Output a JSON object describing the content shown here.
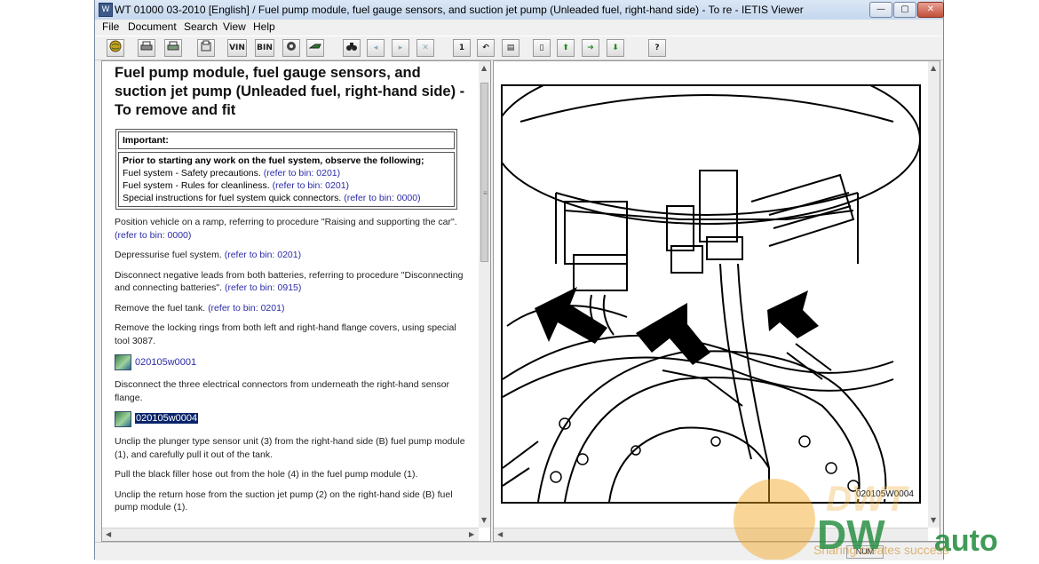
{
  "window": {
    "title": "WT 01000 03-2010 [English] / Fuel pump module, fuel gauge sensors, and suction jet pump (Unleaded fuel, right-hand side) - To re - IETIS Viewer",
    "min_symbol": "—",
    "max_symbol": "▢",
    "close_symbol": "✕"
  },
  "menu": [
    "File",
    "Document",
    "Search",
    "View",
    "Help"
  ],
  "toolbar": {
    "vin_label": "VIN",
    "bin_label": "BIN"
  },
  "document": {
    "title": "Fuel pump module, fuel gauge sensors, and suction jet pump (Unleaded fuel, right-hand side) - To remove and fit",
    "important": {
      "heading": "Important:",
      "lead": "Prior to starting any work on the fuel system, observe the following;",
      "items": [
        {
          "text": "Fuel system - Safety precautions. ",
          "ref": "(refer to bin: 0201)"
        },
        {
          "text": "Fuel system - Rules for cleanliness. ",
          "ref": "(refer to bin: 0201)"
        },
        {
          "text": "Special instructions for fuel system quick connectors. ",
          "ref": "(refer to bin: 0000)"
        }
      ]
    },
    "steps": [
      {
        "text": "Position vehicle on a ramp, referring to procedure \"Raising and supporting the car\". ",
        "ref": "(refer to bin: 0000)"
      },
      {
        "text": "Depressurise fuel system. ",
        "ref": "(refer to bin: 0201)"
      },
      {
        "text": "Disconnect negative leads from both batteries, referring to procedure \"Disconnecting and connecting batteries\". ",
        "ref": "(refer to bin: 0915)"
      },
      {
        "text": "Remove the fuel tank. ",
        "ref": "(refer to bin: 0201)"
      },
      {
        "text": "Remove the locking rings from both left and right-hand flange covers, using special tool 3087.",
        "ref": ""
      },
      {
        "text": "Disconnect the three electrical connectors from underneath the right-hand sensor flange.",
        "ref": ""
      },
      {
        "text": "Unclip the plunger type sensor unit (3) from the right-hand side (B) fuel pump module (1), and carefully pull it out of the tank.",
        "ref": ""
      },
      {
        "text": "Pull the black filler hose out from the hole (4) in the fuel pump module (1).",
        "ref": ""
      },
      {
        "text": "Unclip the return hose from the suction jet pump (2) on the right-hand side (B) fuel pump module (1).",
        "ref": ""
      }
    ],
    "image_refs": [
      "020105w0001",
      "020105w0004"
    ]
  },
  "figure": {
    "label": "020105W0004"
  },
  "status": {
    "num": "NUM"
  },
  "watermark": {
    "brand": "DWT",
    "suffix": "auto",
    "tagline": "Sharing creates success"
  }
}
